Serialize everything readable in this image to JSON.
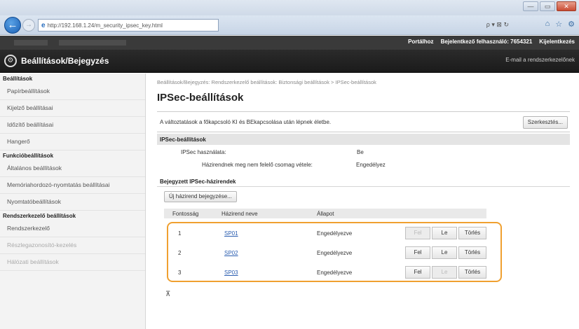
{
  "browser": {
    "url": "http://192.168.1.24/m_security_ipsec_key.html",
    "address_tools": "ρ ▾ ⊠ ↻",
    "nav_icons": [
      "⌂",
      "☆",
      "⚙"
    ],
    "window_controls": [
      "—",
      "▭",
      "✕"
    ]
  },
  "header": {
    "links": [
      "Portálhoz",
      "Bejelentkező felhasználó: 7654321",
      "Kijelentkezés"
    ],
    "title": "Beállítások/Bejegyzés",
    "mail_link": "E-mail a rendszerkezelőnek"
  },
  "sidebar": {
    "sections": [
      {
        "heading": "Beállítások",
        "items": [
          {
            "label": "Papírbeállítások",
            "faded": false
          },
          {
            "label": "Kijelző beállításai",
            "faded": false
          },
          {
            "label": "Időzítő beállításai",
            "faded": false
          },
          {
            "label": "Hangerő",
            "faded": false
          }
        ]
      },
      {
        "heading": "Funkcióbeállítások",
        "items": [
          {
            "label": "Általános beállítások",
            "faded": false
          },
          {
            "label": "Memóriahordozó-nyomtatás beállításai",
            "faded": false
          },
          {
            "label": "Nyomtatóbeállítások",
            "faded": false
          }
        ]
      },
      {
        "heading": "Rendszerkezelő beállítások",
        "items": [
          {
            "label": "Rendszerkezelő",
            "faded": false
          },
          {
            "label": "Részlegazonosító-kezelés",
            "faded": true
          },
          {
            "label": "Hálózati beállítások",
            "faded": true
          }
        ]
      }
    ]
  },
  "main": {
    "breadcrumb": "Beállítások/Bejegyzés: Rendszerkezelő beállítások: Biztonsági beállítások > IPSec-beállítások",
    "title": "IPSec-beállítások",
    "notice": "A változtatások a főkapcsoló KI és BEkapcsolása után lépnek életbe.",
    "edit_button": "Szerkesztés...",
    "ipsec_section": "IPSec-beállítások",
    "ipsec_use_label": "IPSec használata:",
    "ipsec_use_value": "Be",
    "policy_receive_label": "Házirendnek meg nem felelő csomag vétele:",
    "policy_receive_value": "Engedélyez",
    "registered_header": "Bejegyzett IPSec-házirendek",
    "register_button": "Új házirend bejegyzése...",
    "columns": [
      "Fontosság",
      "Házirend neve",
      "Állapot"
    ],
    "rows": [
      {
        "priority": "1",
        "name": "SP01",
        "status": "Engedélyezve",
        "up": "Fel",
        "down": "Le",
        "delete": "Törlés",
        "up_disabled": true,
        "down_disabled": false
      },
      {
        "priority": "2",
        "name": "SP02",
        "status": "Engedélyezve",
        "up": "Fel",
        "down": "Le",
        "delete": "Törlés",
        "up_disabled": false,
        "down_disabled": false
      },
      {
        "priority": "3",
        "name": "SP03",
        "status": "Engedélyezve",
        "up": "Fel",
        "down": "Le",
        "delete": "Törlés",
        "up_disabled": false,
        "down_disabled": true
      }
    ],
    "top_link": "⊼"
  },
  "colors": {
    "highlight": "#f0a030",
    "link": "#2a5db0",
    "header_bg": "#1b1b1b"
  }
}
